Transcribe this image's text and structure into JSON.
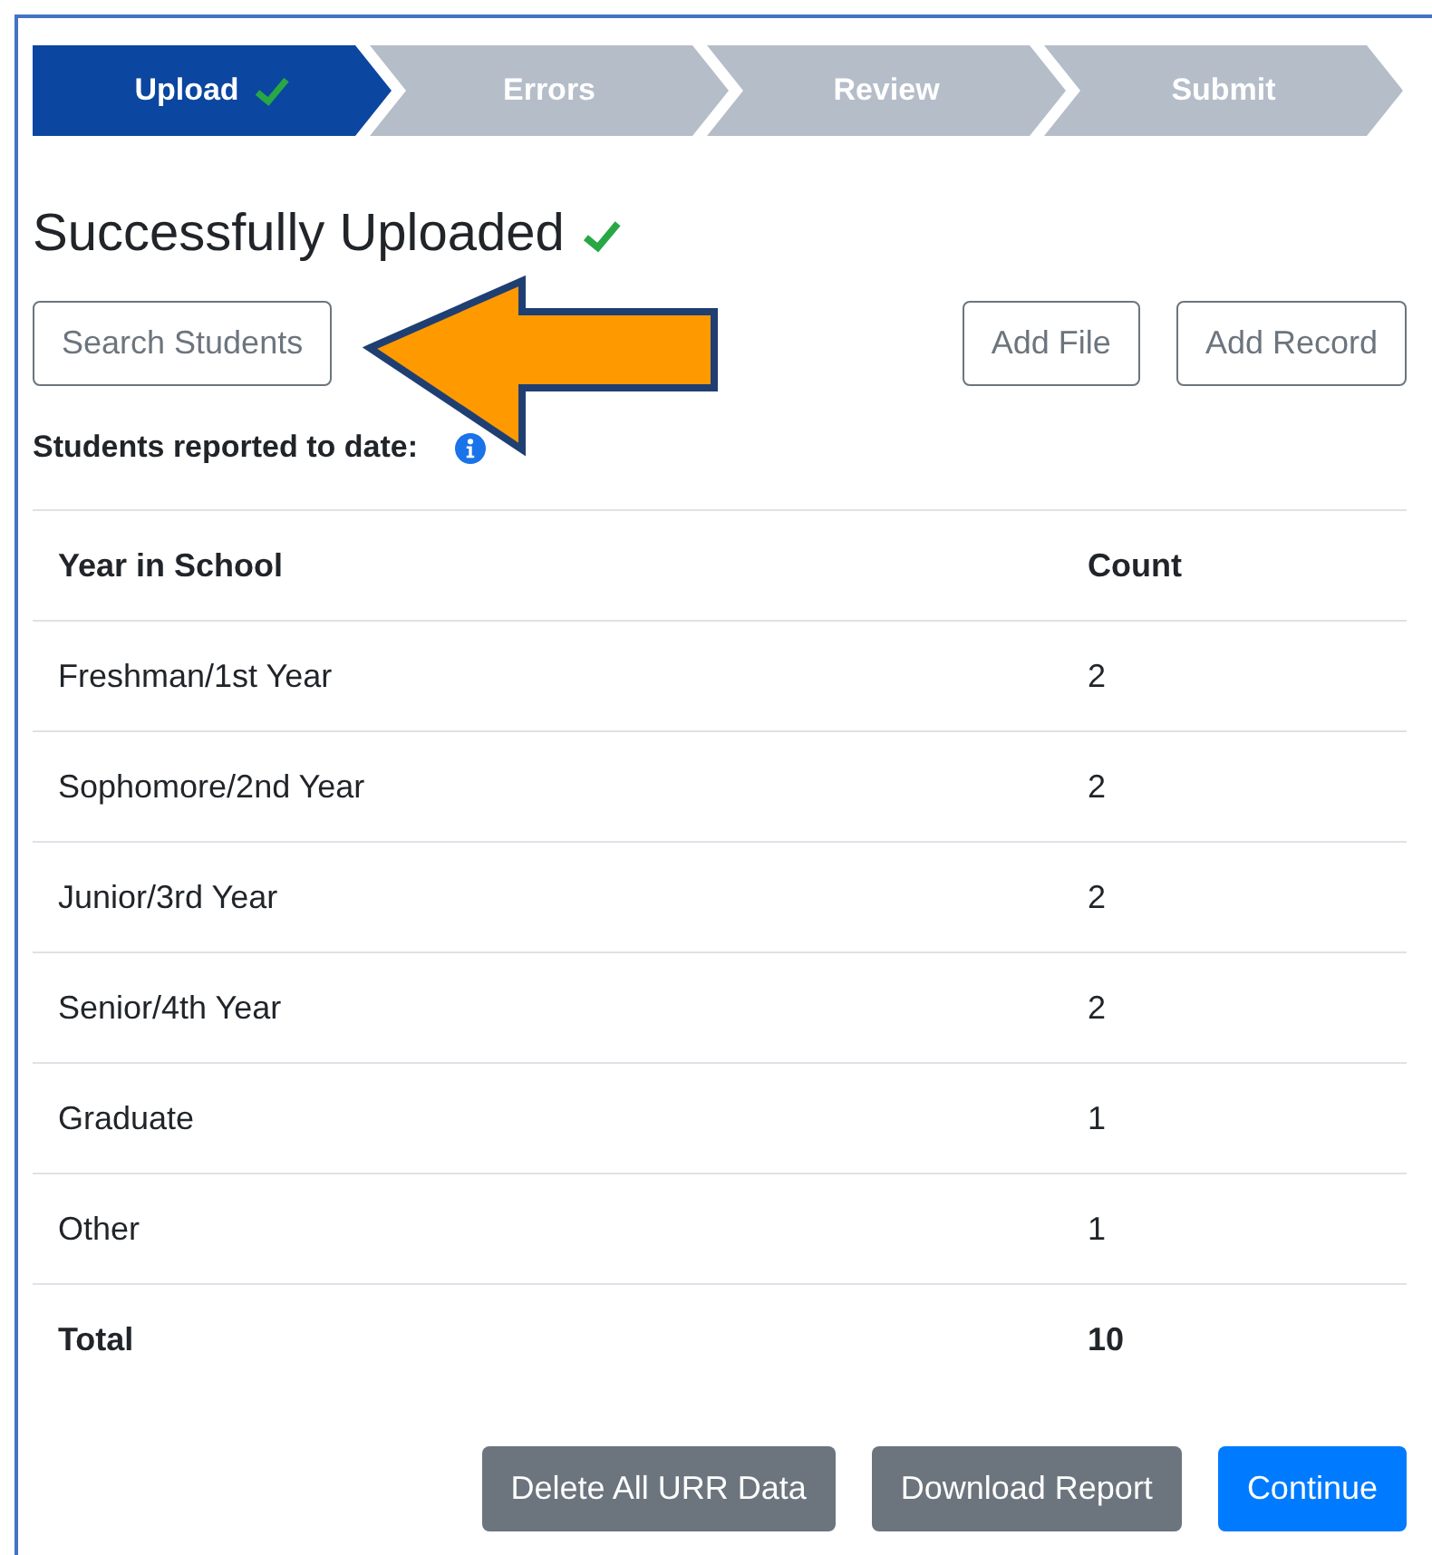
{
  "steps": [
    {
      "label": "Upload",
      "selected": true,
      "done": true
    },
    {
      "label": "Errors",
      "selected": false,
      "done": false
    },
    {
      "label": "Review",
      "selected": false,
      "done": false
    },
    {
      "label": "Submit",
      "selected": false,
      "done": false
    }
  ],
  "heading": "Successfully Uploaded",
  "search_button": "Search Students",
  "actions": [
    "Add File",
    "Add Record"
  ],
  "summary_label": "Students reported to date:",
  "table": {
    "columns": [
      "Year in School",
      "Count"
    ],
    "rows": [
      {
        "cells": [
          "Freshman/1st Year",
          "2"
        ],
        "kind": "data"
      },
      {
        "cells": [
          "Sophomore/2nd Year",
          "2"
        ],
        "kind": "data"
      },
      {
        "cells": [
          "Junior/3rd Year",
          "2"
        ],
        "kind": "data"
      },
      {
        "cells": [
          "Senior/4th Year",
          "2"
        ],
        "kind": "data"
      },
      {
        "cells": [
          "Graduate",
          "1"
        ],
        "kind": "data"
      },
      {
        "cells": [
          "Other",
          "1"
        ],
        "kind": "data"
      },
      {
        "cells": [
          "Total",
          "10"
        ],
        "kind": "total"
      }
    ]
  },
  "footer_buttons": [
    {
      "label": "Delete All URR Data",
      "kind": "secondary"
    },
    {
      "label": "Download Report",
      "kind": "secondary"
    },
    {
      "label": "Continue",
      "kind": "primary"
    }
  ]
}
